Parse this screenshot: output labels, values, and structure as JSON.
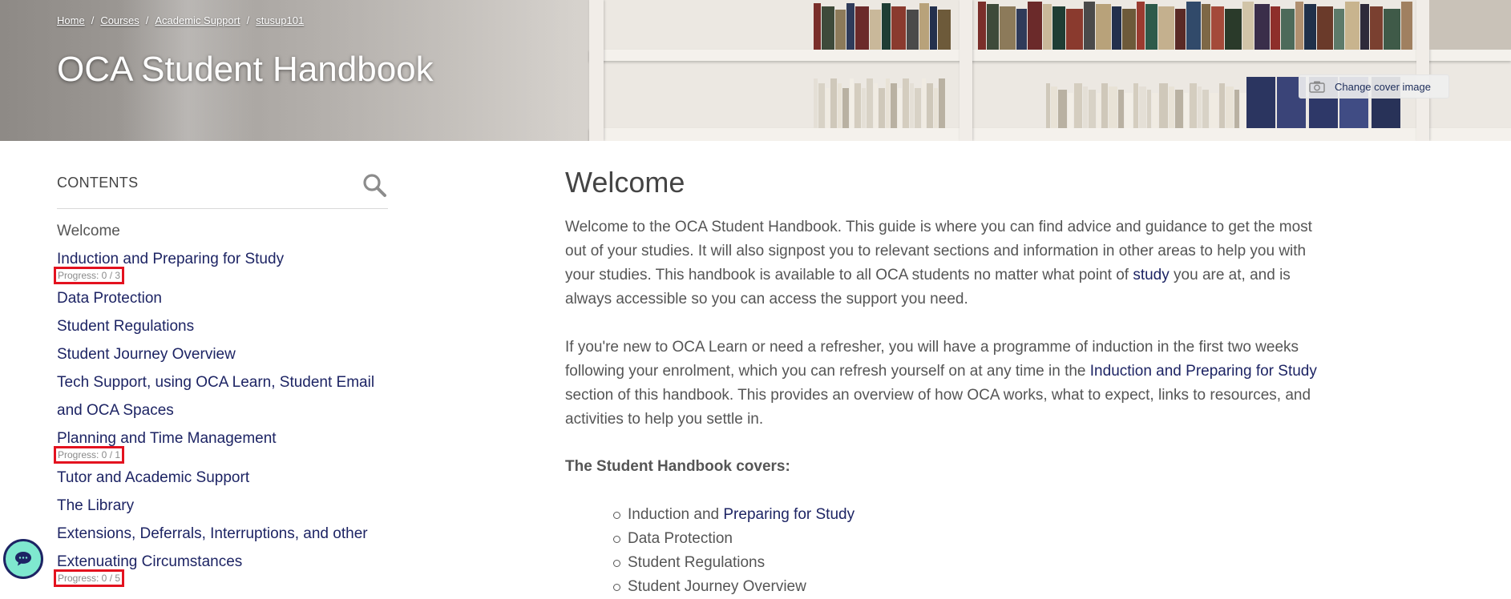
{
  "breadcrumb": [
    {
      "label": "Home"
    },
    {
      "label": "Courses"
    },
    {
      "label": "Academic Support"
    },
    {
      "label": "stusup101"
    }
  ],
  "breadcrumb_separator": "/",
  "page_title": "OCA Student Handbook",
  "cover_button": {
    "label": "Change cover image",
    "icon": "camera-icon"
  },
  "sidebar": {
    "title": "CONTENTS",
    "search_icon": "search-icon",
    "items": [
      {
        "label": "Welcome",
        "current": true,
        "progress": null
      },
      {
        "label": "Induction and Preparing for Study",
        "progress": "Progress: 0 / 3"
      },
      {
        "label": "Data Protection",
        "progress": null
      },
      {
        "label": "Student Regulations",
        "progress": null
      },
      {
        "label": "Student Journey Overview",
        "progress": null
      },
      {
        "label": "Tech Support, using OCA Learn, Student Email and OCA Spaces",
        "progress": null
      },
      {
        "label": "Planning and Time Management",
        "progress": "Progress: 0 / 1"
      },
      {
        "label": "Tutor and Academic Support",
        "progress": null
      },
      {
        "label": "The Library",
        "progress": null
      },
      {
        "label": "Extensions, Deferrals, Interruptions, and other Extenuating Circumstances",
        "progress": "Progress: 0 / 5"
      }
    ]
  },
  "main": {
    "heading": "Welcome",
    "para1": {
      "before_link": "Welcome to the OCA Student Handbook.  This guide is where you can find advice and guidance to get the most out of your studies. It will also signpost you to relevant sections and information in other areas to help you with your studies. This handbook is available to all OCA students no matter what point of ",
      "link": "study",
      "after_link": " you are at, and is always accessible so you can access the support you need."
    },
    "para2": {
      "before_link": "If you're new to OCA Learn or need a refresher, you will have a programme of induction in the first two weeks following your enrolment, which you can refresh yourself on at any time in the ",
      "link": "Induction and Preparing for Study",
      "after_link": " section of this handbook. This provides an overview of how OCA works, what to expect, links to resources, and activities to help you settle in."
    },
    "covers_heading": "The Student Handbook covers:",
    "covers_list": [
      {
        "text": "Induction and ",
        "link": "Preparing for Study"
      },
      {
        "text": "Data Protection",
        "link": ""
      },
      {
        "text": "Student Regulations",
        "link": ""
      },
      {
        "text": "Student Journey Overview",
        "link": ""
      }
    ]
  },
  "chat_button": {
    "icon": "chat-bubble-icon"
  },
  "colors": {
    "link": "#1d2464",
    "text": "#555555",
    "progress_highlight": "#e3121f",
    "chat_bg": "#7fe8cf"
  }
}
